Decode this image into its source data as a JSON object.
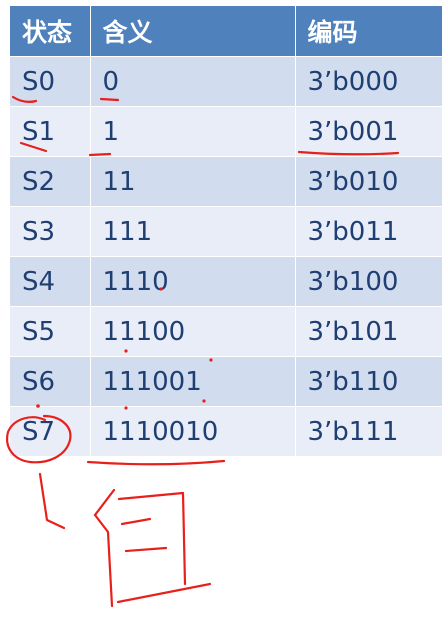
{
  "table": {
    "headers": [
      "状态",
      "含义",
      "编码"
    ],
    "rows": [
      [
        "S0",
        "0",
        "3’b000"
      ],
      [
        "S1",
        "1",
        "3’b001"
      ],
      [
        "S2",
        "11",
        "3’b010"
      ],
      [
        "S3",
        "111",
        "3’b011"
      ],
      [
        "S4",
        "1110",
        "3’b100"
      ],
      [
        "S5",
        "11100",
        "3’b101"
      ],
      [
        "S6",
        "111001",
        "3’b110"
      ],
      [
        "S7",
        "1110010",
        "3’b111"
      ]
    ]
  },
  "colors": {
    "header": "#4f81bd",
    "row_dark": "#d1dcee",
    "row_light": "#e8edf7",
    "text": "#1f3f73",
    "annotation": "#e8201c"
  }
}
